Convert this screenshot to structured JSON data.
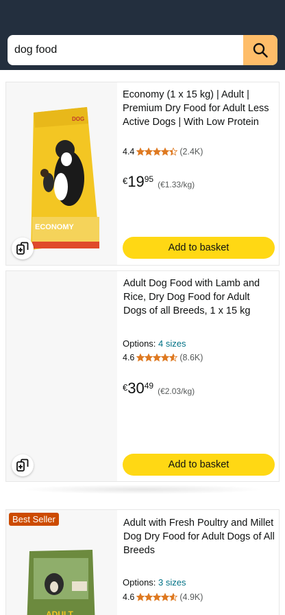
{
  "search": {
    "value": "dog food",
    "placeholder": ""
  },
  "products": [
    {
      "title": "Economy (1 x 15 kg) | Adult | Premium Dry Food for Adult Less Active Dogs | With Low Protein",
      "rating": "4.4",
      "stars": 4.4,
      "rating_count": "(2.4K)",
      "price_currency": "€",
      "price_whole": "19",
      "price_fraction": "95",
      "unit_price": "(€1.33/kg)",
      "basket_label": "Add to basket",
      "package_label": "ECONOMY",
      "package_brand": "DOG"
    },
    {
      "title": "Adult Dog Food with Lamb and Rice, Dry Dog Food for Adult Dogs of all Breeds, 1 x 15 kg",
      "options_label": "Options:",
      "options_value": "4 sizes",
      "rating": "4.6",
      "stars": 4.6,
      "rating_count": "(8.6K)",
      "price_currency": "€",
      "price_whole": "30",
      "price_fraction": "49",
      "unit_price": "(€2.03/kg)",
      "basket_label": "Add to basket"
    },
    {
      "badge": "Best Seller",
      "title": "Adult with Fresh Poultry and Millet Dog Dry Food for Adult Dogs of All Breeds",
      "options_label": "Options:",
      "options_value": "3 sizes",
      "rating": "4.6",
      "stars": 4.6,
      "rating_count": "(4.9K)",
      "package_label": "ADULT"
    }
  ],
  "colors": {
    "header_bg": "#232f3e",
    "search_button": "#febd69",
    "basket_button": "#ffd814",
    "star": "#de7921",
    "link": "#007185",
    "badge": "#cc4b00"
  }
}
